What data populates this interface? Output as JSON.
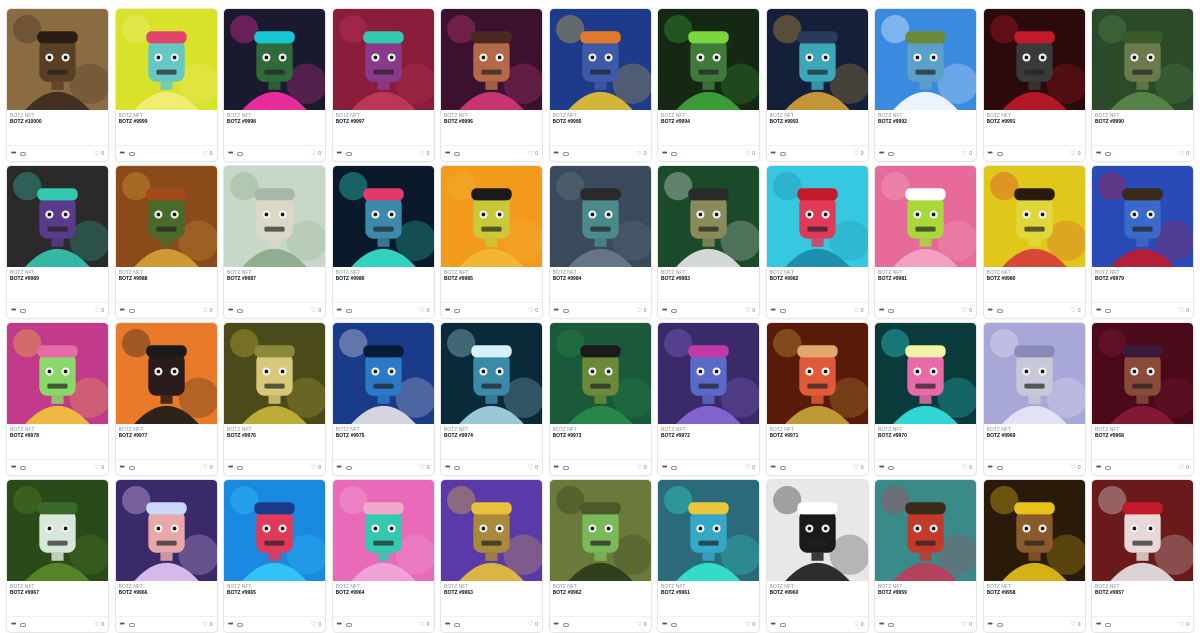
{
  "collection_name": "BOTZ NFT",
  "items": [
    {
      "token": "BOTZ #10000",
      "favorites": "0",
      "bg": "#8a6b42",
      "accent": "#3b2a1f",
      "face": "#5b3f25",
      "hair": "#2a1e14"
    },
    {
      "token": "BOTZ #9999",
      "favorites": "0",
      "bg": "#d8e22a",
      "accent": "#f2f07a",
      "face": "#65c8c4",
      "hair": "#e0456a"
    },
    {
      "token": "BOTZ #9998",
      "favorites": "0",
      "bg": "#1a1a2e",
      "accent": "#ff2fa8",
      "face": "#2f6b3a",
      "hair": "#19c6d6"
    },
    {
      "token": "BOTZ #9997",
      "favorites": "0",
      "bg": "#8a1d3c",
      "accent": "#c23a5a",
      "face": "#8a3a8a",
      "hair": "#35c8b0"
    },
    {
      "token": "BOTZ #9996",
      "favorites": "0",
      "bg": "#3a1230",
      "accent": "#d63a7a",
      "face": "#b46a4a",
      "hair": "#4a2a20"
    },
    {
      "token": "BOTZ #9995",
      "favorites": "0",
      "bg": "#1e3a8a",
      "accent": "#e8c230",
      "face": "#3f5aa8",
      "hair": "#e07a2a"
    },
    {
      "token": "BOTZ #9994",
      "favorites": "0",
      "bg": "#142814",
      "accent": "#3fa83a",
      "face": "#3f7a3a",
      "hair": "#7ad63a"
    },
    {
      "token": "BOTZ #9993",
      "favorites": "0",
      "bg": "#14203a",
      "accent": "#d6a23a",
      "face": "#3aa8b8",
      "hair": "#2a3a5a"
    },
    {
      "token": "BOTZ #9992",
      "favorites": "0",
      "bg": "#3a8ae0",
      "accent": "#ffffff",
      "face": "#5aa0c8",
      "hair": "#6a8a3a"
    },
    {
      "token": "BOTZ #9991",
      "favorites": "0",
      "bg": "#2a0a0a",
      "accent": "#c21a2a",
      "face": "#3a3a3a",
      "hair": "#c21a2a"
    },
    {
      "token": "BOTZ #9990",
      "favorites": "0",
      "bg": "#2a4a2a",
      "accent": "#5a8a4a",
      "face": "#6a7a4a",
      "hair": "#3a5a2a"
    },
    {
      "token": "BOTZ #9989",
      "favorites": "0",
      "bg": "#2a2a2a",
      "accent": "#35c8b0",
      "face": "#5a3a8a",
      "hair": "#35c8b0"
    },
    {
      "token": "BOTZ #9988",
      "favorites": "0",
      "bg": "#8a4a1a",
      "accent": "#d6a23a",
      "face": "#4a6a2a",
      "hair": "#a24a1a"
    },
    {
      "token": "BOTZ #9987",
      "favorites": "0",
      "bg": "#c8d8c8",
      "accent": "#8aa88a",
      "face": "#dcd8c8",
      "hair": "#a8b8a8"
    },
    {
      "token": "BOTZ #9986",
      "favorites": "0",
      "bg": "#0a1a2a",
      "accent": "#35e8d0",
      "face": "#3a8aa8",
      "hair": "#e03a6a"
    },
    {
      "token": "BOTZ #9985",
      "favorites": "0",
      "bg": "#f29a1a",
      "accent": "#f2b83a",
      "face": "#c8c83a",
      "hair": "#1a1a1a"
    },
    {
      "token": "BOTZ #9984",
      "favorites": "0",
      "bg": "#3a4a5a",
      "accent": "#6a7a8a",
      "face": "#4a8a8a",
      "hair": "#2a2a2a"
    },
    {
      "token": "BOTZ #9983",
      "favorites": "0",
      "bg": "#1a4a2a",
      "accent": "#e8e8e8",
      "face": "#8a8a5a",
      "hair": "#2a2a2a"
    },
    {
      "token": "BOTZ #9982",
      "favorites": "0",
      "bg": "#35c8e0",
      "accent": "#1a8aa8",
      "face": "#e03a5a",
      "hair": "#c21a2a"
    },
    {
      "token": "BOTZ #9981",
      "favorites": "0",
      "bg": "#e86a9a",
      "accent": "#f2a8c8",
      "face": "#a8d83a",
      "hair": "#ffffff"
    },
    {
      "token": "BOTZ #9980",
      "favorites": "0",
      "bg": "#e0c81a",
      "accent": "#d63a3a",
      "face": "#e0d83a",
      "hair": "#2a1a0a"
    },
    {
      "token": "BOTZ #9979",
      "favorites": "0",
      "bg": "#2a4ab8",
      "accent": "#c21a2a",
      "face": "#3a6ac8",
      "hair": "#3a2a1a"
    },
    {
      "token": "BOTZ #9978",
      "favorites": "0",
      "bg": "#c23a8a",
      "accent": "#f2c83a",
      "face": "#8ad86a",
      "hair": "#e86aa8"
    },
    {
      "token": "BOTZ #9977",
      "favorites": "0",
      "bg": "#e87a2a",
      "accent": "#1a1a1a",
      "face": "#2a1a1a",
      "hair": "#1a1a1a"
    },
    {
      "token": "BOTZ #9976",
      "favorites": "0",
      "bg": "#4a4a1a",
      "accent": "#c8b83a",
      "face": "#d8c87a",
      "hair": "#8a8a3a"
    },
    {
      "token": "BOTZ #9975",
      "favorites": "0",
      "bg": "#1a3a8a",
      "accent": "#e8e8e8",
      "face": "#2a7ac8",
      "hair": "#0a1a3a"
    },
    {
      "token": "BOTZ #9974",
      "favorites": "0",
      "bg": "#0a2a3a",
      "accent": "#a8d8e8",
      "face": "#3a8aa8",
      "hair": "#d8f0f8"
    },
    {
      "token": "BOTZ #9973",
      "favorites": "0",
      "bg": "#1a5a3a",
      "accent": "#2a8a4a",
      "face": "#6a8a3a",
      "hair": "#1a1a1a"
    },
    {
      "token": "BOTZ #9972",
      "favorites": "0",
      "bg": "#3a2a6a",
      "accent": "#8a6ad8",
      "face": "#5a6ac8",
      "hair": "#c23aa8"
    },
    {
      "token": "BOTZ #9971",
      "favorites": "0",
      "bg": "#5a1a0a",
      "accent": "#c8a83a",
      "face": "#e05a3a",
      "hair": "#e0a86a"
    },
    {
      "token": "BOTZ #9970",
      "favorites": "0",
      "bg": "#0a3a3a",
      "accent": "#35e8e8",
      "face": "#e86aa8",
      "hair": "#f2f2a8"
    },
    {
      "token": "BOTZ #9969",
      "favorites": "0",
      "bg": "#a8a8d8",
      "accent": "#e8e8f8",
      "face": "#c8c8d8",
      "hair": "#8a8ab8"
    },
    {
      "token": "BOTZ #9968",
      "favorites": "0",
      "bg": "#4a0a1a",
      "accent": "#8a1a3a",
      "face": "#8a4a3a",
      "hair": "#3a1a3a"
    },
    {
      "token": "BOTZ #9967",
      "favorites": "0",
      "bg": "#2a4a1a",
      "accent": "#5a8a2a",
      "face": "#d8e8d8",
      "hair": "#3a6a2a"
    },
    {
      "token": "BOTZ #9966",
      "favorites": "0",
      "bg": "#3a2a6a",
      "accent": "#e8c8f8",
      "face": "#e8a8a8",
      "hair": "#c8d8f8"
    },
    {
      "token": "BOTZ #9965",
      "favorites": "0",
      "bg": "#1a8ae0",
      "accent": "#35c8f8",
      "face": "#e03a5a",
      "hair": "#1a3a8a"
    },
    {
      "token": "BOTZ #9964",
      "favorites": "0",
      "bg": "#e86ab8",
      "accent": "#f2a8d8",
      "face": "#35c8b0",
      "hair": "#f2a8c8"
    },
    {
      "token": "BOTZ #9963",
      "favorites": "0",
      "bg": "#5a3aa8",
      "accent": "#e8c23a",
      "face": "#a88a3a",
      "hair": "#e8c23a"
    },
    {
      "token": "BOTZ #9962",
      "favorites": "0",
      "bg": "#6a7a3a",
      "accent": "#2a3a1a",
      "face": "#7ab85a",
      "hair": "#4a5a2a"
    },
    {
      "token": "BOTZ #9961",
      "favorites": "0",
      "bg": "#2a6a7a",
      "accent": "#35e8d0",
      "face": "#35a8c8",
      "hair": "#e8c83a"
    },
    {
      "token": "BOTZ #9960",
      "favorites": "0",
      "bg": "#e8e8e8",
      "accent": "#1a1a1a",
      "face": "#1a1a1a",
      "hair": "#ffffff"
    },
    {
      "token": "BOTZ #9959",
      "favorites": "0",
      "bg": "#3a8a8a",
      "accent": "#c23a5a",
      "face": "#c23a2a",
      "hair": "#3a2a1a"
    },
    {
      "token": "BOTZ #9958",
      "favorites": "0",
      "bg": "#2a1a0a",
      "accent": "#e8c21a",
      "face": "#8a5a2a",
      "hair": "#e8c21a"
    },
    {
      "token": "BOTZ #9957",
      "favorites": "0",
      "bg": "#6a1a1a",
      "accent": "#e8e8e8",
      "face": "#e8d8d8",
      "hair": "#c21a2a"
    }
  ]
}
